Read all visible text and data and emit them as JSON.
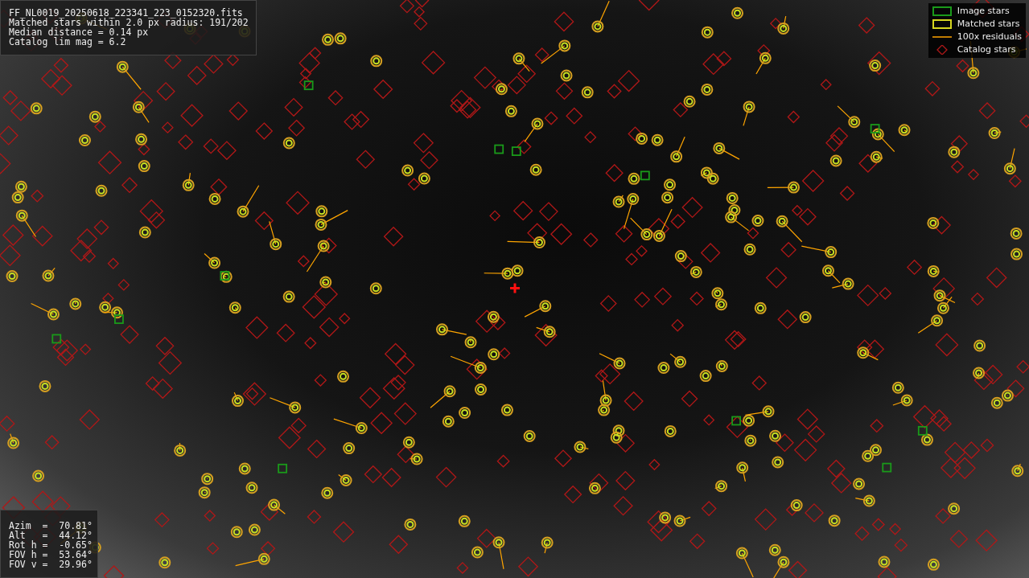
{
  "info_box": {
    "lines": [
      "FF_NL0019_20250618_223341_223_0152320.fits",
      "Matched stars within 2.0 px radius: 191/202",
      "Median distance = 0.14 px",
      "Catalog lim mag = 6.2"
    ]
  },
  "legend": [
    {
      "kind": "image",
      "label": "Image stars"
    },
    {
      "kind": "matched",
      "label": "Matched stars"
    },
    {
      "kind": "residual",
      "label": "100x residuals"
    },
    {
      "kind": "catalog",
      "label": "Catalog stars"
    }
  ],
  "pointing_box": {
    "lines": [
      "Azim  =  70.81°",
      "Alt   =  44.12°",
      "Rot h =  -0.65°",
      "FOV h =  53.64°",
      "FOV v =  29.96°"
    ]
  }
}
